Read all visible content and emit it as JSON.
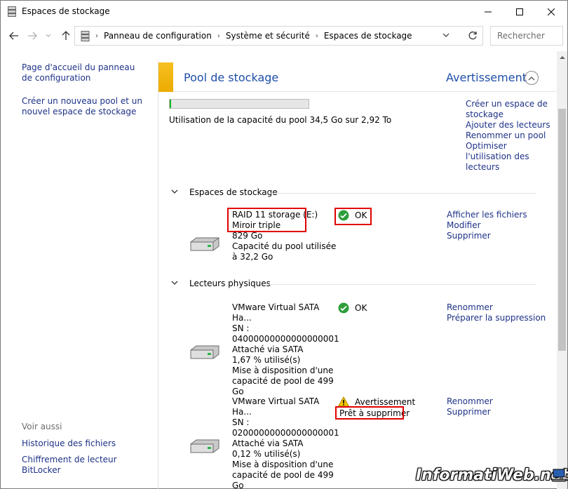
{
  "window": {
    "title": "Espaces de stockage"
  },
  "address": {
    "crumbs": [
      "Panneau de configuration",
      "Système et sécurité",
      "Espaces de stockage"
    ],
    "search_placeholder": "Rechercher"
  },
  "leftnav": {
    "home": "Page d'accueil du panneau de configuration",
    "create_pool": "Créer un nouveau pool et un nouvel espace de stockage",
    "see_also": "Voir aussi",
    "file_history": "Historique des fichiers",
    "bitlocker": "Chiffrement de lecteur BitLocker"
  },
  "pool": {
    "title": "Pool de stockage",
    "status": "Avertissement",
    "usage_fraction": 0.012,
    "usage_text": "Utilisation de la capacité du pool 34,5 Go sur 2,92 To",
    "actions": [
      "Créer un espace de stockage",
      "Ajouter des lecteurs",
      "Renommer un pool",
      "Optimiser l'utilisation des lecteurs"
    ]
  },
  "spaces_section": {
    "title": "Espaces de stockage",
    "items": [
      {
        "name": "RAID 11 storage (E:)",
        "type": "Miroir triple",
        "size": "829 Go",
        "pool_usage": "Capacité du pool utilisée à 32,2 Go",
        "status": "OK",
        "links": [
          "Afficher les fichiers",
          "Modifier",
          "Supprimer"
        ]
      }
    ]
  },
  "drives_section": {
    "title": "Lecteurs physiques",
    "items": [
      {
        "name": "VMware Virtual SATA Ha...",
        "sn": "SN :",
        "serial": "04000000000000000001",
        "attach": "Attaché via SATA",
        "used": "1,67 % utilisé(s)",
        "capacity": "Mise à disposition d'une capacité de pool de 499 Go",
        "status": "OK",
        "substatus": "",
        "links": [
          "Renommer",
          "Préparer la suppression"
        ]
      },
      {
        "name": "VMware Virtual SATA Ha...",
        "sn": "SN :",
        "serial": "02000000000000000001",
        "attach": "Attaché via SATA",
        "used": "0,12 % utilisé(s)",
        "capacity": "Mise à disposition d'une capacité de pool de 499 Go",
        "status": "Avertissement",
        "substatus": "Prêt à supprimer",
        "links": [
          "Renommer",
          "Supprimer"
        ]
      }
    ]
  },
  "watermark": "InformatiWeb.net",
  "colors": {
    "link": "#1e3287",
    "accent": "#1e4ea8",
    "warning_stripe": "#f4b400",
    "progress": "#06b025",
    "highlight": "#e00000"
  }
}
